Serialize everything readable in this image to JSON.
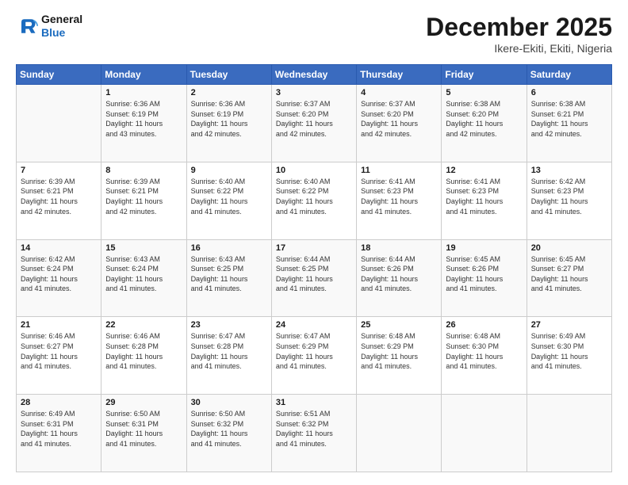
{
  "header": {
    "logo_line1": "General",
    "logo_line2": "Blue",
    "month": "December 2025",
    "location": "Ikere-Ekiti, Ekiti, Nigeria"
  },
  "weekdays": [
    "Sunday",
    "Monday",
    "Tuesday",
    "Wednesday",
    "Thursday",
    "Friday",
    "Saturday"
  ],
  "weeks": [
    [
      {
        "day": "",
        "info": ""
      },
      {
        "day": "1",
        "info": "Sunrise: 6:36 AM\nSunset: 6:19 PM\nDaylight: 11 hours\nand 43 minutes."
      },
      {
        "day": "2",
        "info": "Sunrise: 6:36 AM\nSunset: 6:19 PM\nDaylight: 11 hours\nand 42 minutes."
      },
      {
        "day": "3",
        "info": "Sunrise: 6:37 AM\nSunset: 6:20 PM\nDaylight: 11 hours\nand 42 minutes."
      },
      {
        "day": "4",
        "info": "Sunrise: 6:37 AM\nSunset: 6:20 PM\nDaylight: 11 hours\nand 42 minutes."
      },
      {
        "day": "5",
        "info": "Sunrise: 6:38 AM\nSunset: 6:20 PM\nDaylight: 11 hours\nand 42 minutes."
      },
      {
        "day": "6",
        "info": "Sunrise: 6:38 AM\nSunset: 6:21 PM\nDaylight: 11 hours\nand 42 minutes."
      }
    ],
    [
      {
        "day": "7",
        "info": "Sunrise: 6:39 AM\nSunset: 6:21 PM\nDaylight: 11 hours\nand 42 minutes."
      },
      {
        "day": "8",
        "info": "Sunrise: 6:39 AM\nSunset: 6:21 PM\nDaylight: 11 hours\nand 42 minutes."
      },
      {
        "day": "9",
        "info": "Sunrise: 6:40 AM\nSunset: 6:22 PM\nDaylight: 11 hours\nand 41 minutes."
      },
      {
        "day": "10",
        "info": "Sunrise: 6:40 AM\nSunset: 6:22 PM\nDaylight: 11 hours\nand 41 minutes."
      },
      {
        "day": "11",
        "info": "Sunrise: 6:41 AM\nSunset: 6:23 PM\nDaylight: 11 hours\nand 41 minutes."
      },
      {
        "day": "12",
        "info": "Sunrise: 6:41 AM\nSunset: 6:23 PM\nDaylight: 11 hours\nand 41 minutes."
      },
      {
        "day": "13",
        "info": "Sunrise: 6:42 AM\nSunset: 6:23 PM\nDaylight: 11 hours\nand 41 minutes."
      }
    ],
    [
      {
        "day": "14",
        "info": "Sunrise: 6:42 AM\nSunset: 6:24 PM\nDaylight: 11 hours\nand 41 minutes."
      },
      {
        "day": "15",
        "info": "Sunrise: 6:43 AM\nSunset: 6:24 PM\nDaylight: 11 hours\nand 41 minutes."
      },
      {
        "day": "16",
        "info": "Sunrise: 6:43 AM\nSunset: 6:25 PM\nDaylight: 11 hours\nand 41 minutes."
      },
      {
        "day": "17",
        "info": "Sunrise: 6:44 AM\nSunset: 6:25 PM\nDaylight: 11 hours\nand 41 minutes."
      },
      {
        "day": "18",
        "info": "Sunrise: 6:44 AM\nSunset: 6:26 PM\nDaylight: 11 hours\nand 41 minutes."
      },
      {
        "day": "19",
        "info": "Sunrise: 6:45 AM\nSunset: 6:26 PM\nDaylight: 11 hours\nand 41 minutes."
      },
      {
        "day": "20",
        "info": "Sunrise: 6:45 AM\nSunset: 6:27 PM\nDaylight: 11 hours\nand 41 minutes."
      }
    ],
    [
      {
        "day": "21",
        "info": "Sunrise: 6:46 AM\nSunset: 6:27 PM\nDaylight: 11 hours\nand 41 minutes."
      },
      {
        "day": "22",
        "info": "Sunrise: 6:46 AM\nSunset: 6:28 PM\nDaylight: 11 hours\nand 41 minutes."
      },
      {
        "day": "23",
        "info": "Sunrise: 6:47 AM\nSunset: 6:28 PM\nDaylight: 11 hours\nand 41 minutes."
      },
      {
        "day": "24",
        "info": "Sunrise: 6:47 AM\nSunset: 6:29 PM\nDaylight: 11 hours\nand 41 minutes."
      },
      {
        "day": "25",
        "info": "Sunrise: 6:48 AM\nSunset: 6:29 PM\nDaylight: 11 hours\nand 41 minutes."
      },
      {
        "day": "26",
        "info": "Sunrise: 6:48 AM\nSunset: 6:30 PM\nDaylight: 11 hours\nand 41 minutes."
      },
      {
        "day": "27",
        "info": "Sunrise: 6:49 AM\nSunset: 6:30 PM\nDaylight: 11 hours\nand 41 minutes."
      }
    ],
    [
      {
        "day": "28",
        "info": "Sunrise: 6:49 AM\nSunset: 6:31 PM\nDaylight: 11 hours\nand 41 minutes."
      },
      {
        "day": "29",
        "info": "Sunrise: 6:50 AM\nSunset: 6:31 PM\nDaylight: 11 hours\nand 41 minutes."
      },
      {
        "day": "30",
        "info": "Sunrise: 6:50 AM\nSunset: 6:32 PM\nDaylight: 11 hours\nand 41 minutes."
      },
      {
        "day": "31",
        "info": "Sunrise: 6:51 AM\nSunset: 6:32 PM\nDaylight: 11 hours\nand 41 minutes."
      },
      {
        "day": "",
        "info": ""
      },
      {
        "day": "",
        "info": ""
      },
      {
        "day": "",
        "info": ""
      }
    ]
  ]
}
